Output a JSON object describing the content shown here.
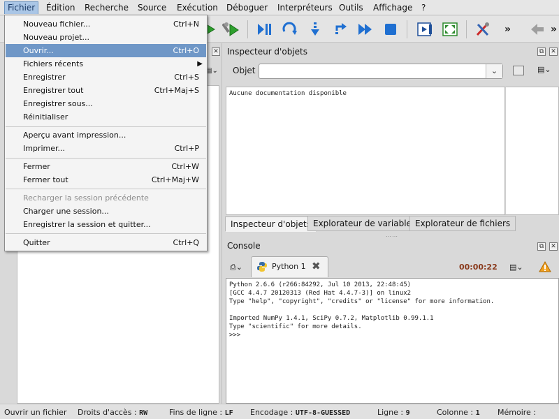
{
  "menubar": [
    "Fichier",
    "Édition",
    "Recherche",
    "Source",
    "Exécution",
    "Déboguer",
    "Interpréteurs",
    "Outils",
    "Affichage",
    "?"
  ],
  "file_menu": {
    "items": [
      {
        "label": "Nouveau fichier...",
        "shortcut": "Ctrl+N"
      },
      {
        "label": "Nouveau projet...",
        "shortcut": ""
      },
      {
        "label": "Ouvrir...",
        "shortcut": "Ctrl+O"
      },
      {
        "label": "Fichiers récents",
        "shortcut": ""
      },
      {
        "label": "Enregistrer",
        "shortcut": "Ctrl+S"
      },
      {
        "label": "Enregistrer tout",
        "shortcut": "Ctrl+Maj+S"
      },
      {
        "label": "Enregistrer sous...",
        "shortcut": ""
      },
      {
        "label": "Réinitialiser",
        "shortcut": ""
      },
      {
        "label": "Aperçu avant impression...",
        "shortcut": ""
      },
      {
        "label": "Imprimer...",
        "shortcut": "Ctrl+P"
      },
      {
        "label": "Fermer",
        "shortcut": "Ctrl+W"
      },
      {
        "label": "Fermer tout",
        "shortcut": "Ctrl+Maj+W"
      },
      {
        "label": "Recharger la session précédente",
        "shortcut": ""
      },
      {
        "label": "Charger une session...",
        "shortcut": ""
      },
      {
        "label": "Enregistrer la session et quitter...",
        "shortcut": ""
      },
      {
        "label": "Quitter",
        "shortcut": "Ctrl+Q"
      }
    ]
  },
  "object_inspector": {
    "title": "Inspecteur d'objets",
    "object_label": "Objet",
    "object_value": "",
    "doc_text": "Aucune documentation disponible",
    "tabs": [
      "Inspecteur d'objets",
      "Explorateur de variables",
      "Explorateur de fichiers"
    ]
  },
  "console": {
    "title": "Console",
    "tab_label": "Python 1",
    "timer": "00:00:22",
    "output": "Python 2.6.6 (r266:84292, Jul 10 2013, 22:48:45)\n[GCC 4.4.7 20120313 (Red Hat 4.4.7-3)] on linux2\nType \"help\", \"copyright\", \"credits\" or \"license\" for more information.\n\nImported NumPy 1.4.1, SciPy 0.7.2, Matplotlib 0.99.1.1\nType \"scientific\" for more details.\n>>>"
  },
  "statusbar": {
    "message": "Ouvrir un fichier",
    "access_label": "Droits d'accès :",
    "access_value": "RW",
    "eol_label": "Fins de ligne :",
    "eol_value": "LF",
    "encoding_label": "Encodage :",
    "encoding_value": "UTF-8-GUESSED",
    "line_label": "Ligne :",
    "line_value": "9",
    "column_label": "Colonne :",
    "column_value": "1",
    "memory_label": "Mémoire :"
  },
  "colors": {
    "menu_highlight": "#6f97c7",
    "timer": "#8a3b1d",
    "run_green": "#2ea02e",
    "debug_blue": "#1f6fd1"
  }
}
